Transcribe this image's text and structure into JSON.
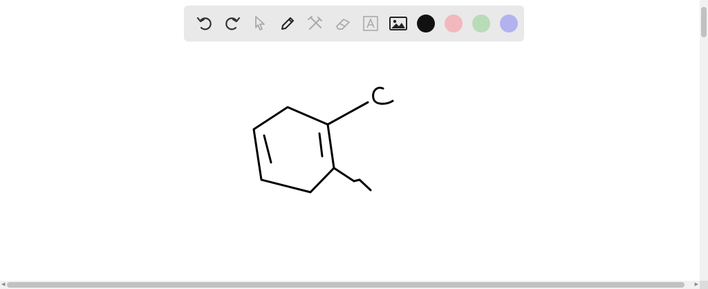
{
  "toolbar": {
    "tools": [
      {
        "name": "undo-icon",
        "enabled": true
      },
      {
        "name": "redo-icon",
        "enabled": true
      },
      {
        "name": "select-pointer-icon",
        "enabled": false
      },
      {
        "name": "pencil-icon",
        "enabled": true
      },
      {
        "name": "tools-crossed-icon",
        "enabled": false
      },
      {
        "name": "eraser-icon",
        "enabled": false
      },
      {
        "name": "text-box-icon",
        "enabled": false
      },
      {
        "name": "image-icon",
        "enabled": true
      }
    ],
    "colors": [
      {
        "name": "black",
        "hex": "#111111"
      },
      {
        "name": "pink",
        "hex": "#f2b8bd"
      },
      {
        "name": "green",
        "hex": "#b8dcb8"
      },
      {
        "name": "purple",
        "hex": "#b3b2ee"
      }
    ]
  },
  "drawing": {
    "substituent_label": "C"
  }
}
